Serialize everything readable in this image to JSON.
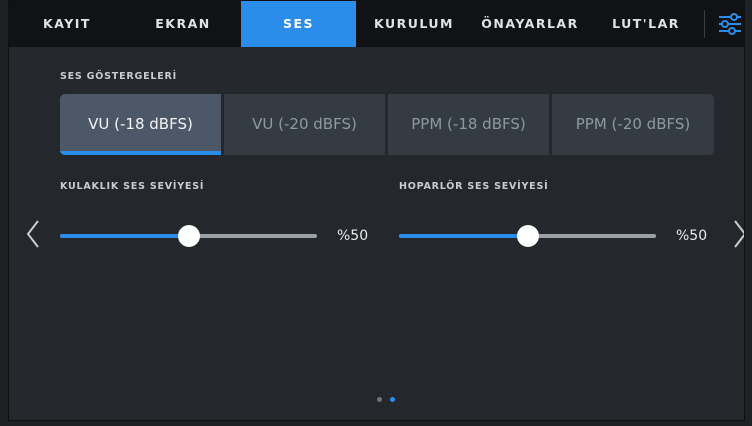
{
  "tabs": [
    {
      "label": "KAYIT",
      "active": false
    },
    {
      "label": "EKRAN",
      "active": false
    },
    {
      "label": "SES",
      "active": true
    },
    {
      "label": "KURULUM",
      "active": false
    },
    {
      "label": "ÖNAYARLAR",
      "active": false
    },
    {
      "label": "LUT'LAR",
      "active": false
    }
  ],
  "menu_icon": "settings-sliders-icon",
  "meters": {
    "label": "SES GÖSTERGELERİ",
    "options": [
      "VU (-18 dBFS)",
      "VU (-20 dBFS)",
      "PPM (-18 dBFS)",
      "PPM (-20 dBFS)"
    ],
    "selected": "VU (-18 dBFS)"
  },
  "headphone": {
    "label": "KULAKLIK SES SEVİYESİ",
    "level": 0.5,
    "value_text": "%50"
  },
  "speaker": {
    "label": "HOPARLÖR SES SEVİYESİ",
    "level": 0.5,
    "value_text": "%50"
  },
  "navigation": {
    "prev_icon": "chevron-left-icon",
    "next_icon": "chevron-right-icon"
  },
  "pagination": {
    "pages": 2,
    "current": 2
  },
  "colors": {
    "accent": "#2a8dea",
    "tabbar": "#101214",
    "background": "#24282c",
    "segment": "#353b42",
    "segment_active": "#4c5868"
  }
}
